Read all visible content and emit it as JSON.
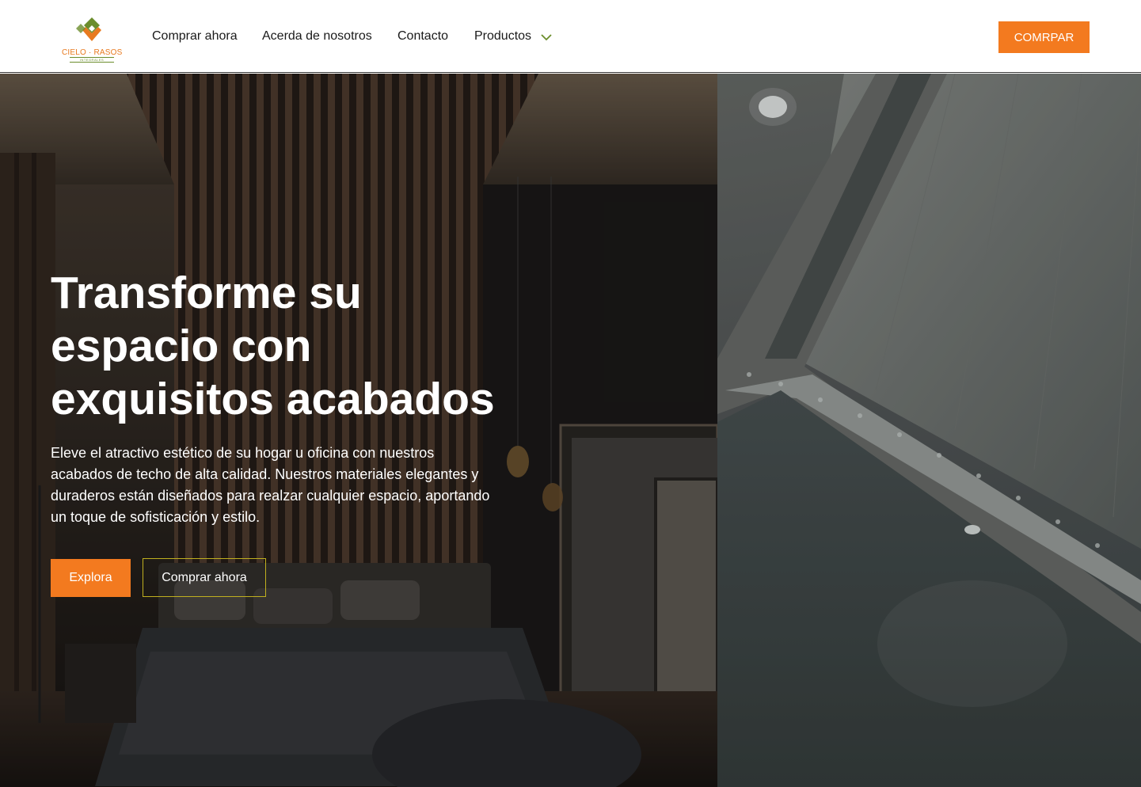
{
  "brand": {
    "logo_text": "CIELO · RASOS",
    "logo_subtext": "INTEGRALES",
    "colors": {
      "orange": "#f37a1f",
      "green": "#6b8d2c",
      "gold": "#c0b01f"
    }
  },
  "nav": {
    "items": [
      {
        "label": "Comprar ahora"
      },
      {
        "label": "Acerda de nosotros"
      },
      {
        "label": "Contacto"
      },
      {
        "label": "Productos",
        "icon": "chevron-down-icon"
      }
    ],
    "cta_label": "COMRPAR"
  },
  "hero": {
    "headline": "Transforme su espacio con exquisitos acabados",
    "lead": "Eleve el atractivo estético de su hogar u oficina con nuestros acabados de techo de alta calidad. Nuestros materiales elegantes y duraderos están diseñados para realzar cualquier espacio, aportando un toque de sofisticación y estilo.",
    "primary_button": "Explora",
    "secondary_button": "Comprar ahora"
  }
}
